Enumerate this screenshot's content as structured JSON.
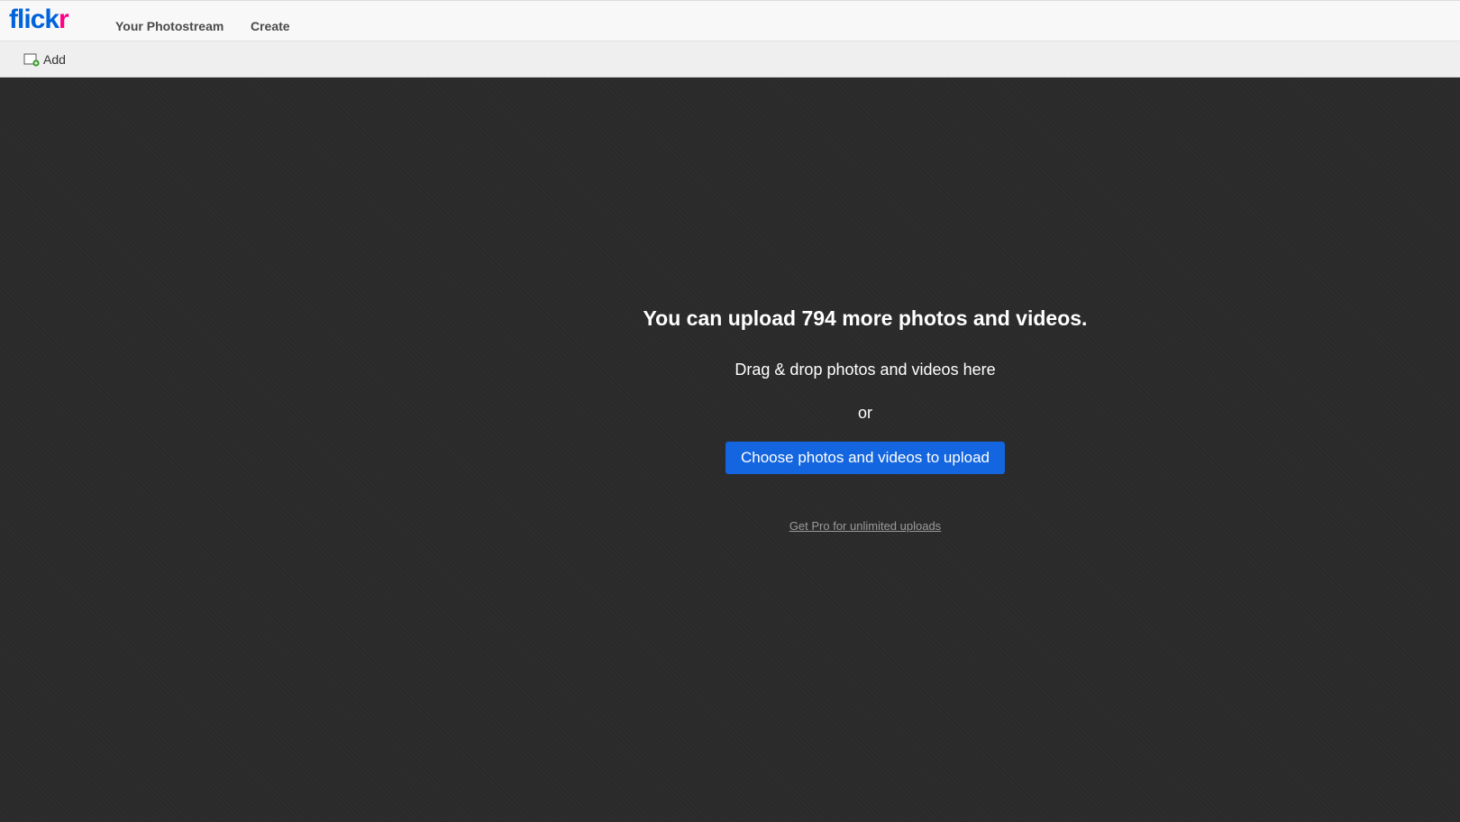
{
  "header": {
    "logo_text_main": "flick",
    "logo_text_accent": "r",
    "nav": {
      "photostream_label": "Your Photostream",
      "create_label": "Create"
    }
  },
  "toolbar": {
    "add_label": "Add",
    "add_icon": "add-photo-icon"
  },
  "dropzone": {
    "title": "You can upload 794 more photos and videos.",
    "drag_text": "Drag & drop photos and videos here",
    "or_text": "or",
    "choose_button_label": "Choose photos and videos to upload",
    "pro_link_label": "Get Pro for unlimited uploads"
  },
  "colors": {
    "brand_blue": "#0063dc",
    "brand_pink": "#ff0084",
    "button_blue": "#1366e0",
    "dropzone_bg": "#2b2b2b"
  }
}
